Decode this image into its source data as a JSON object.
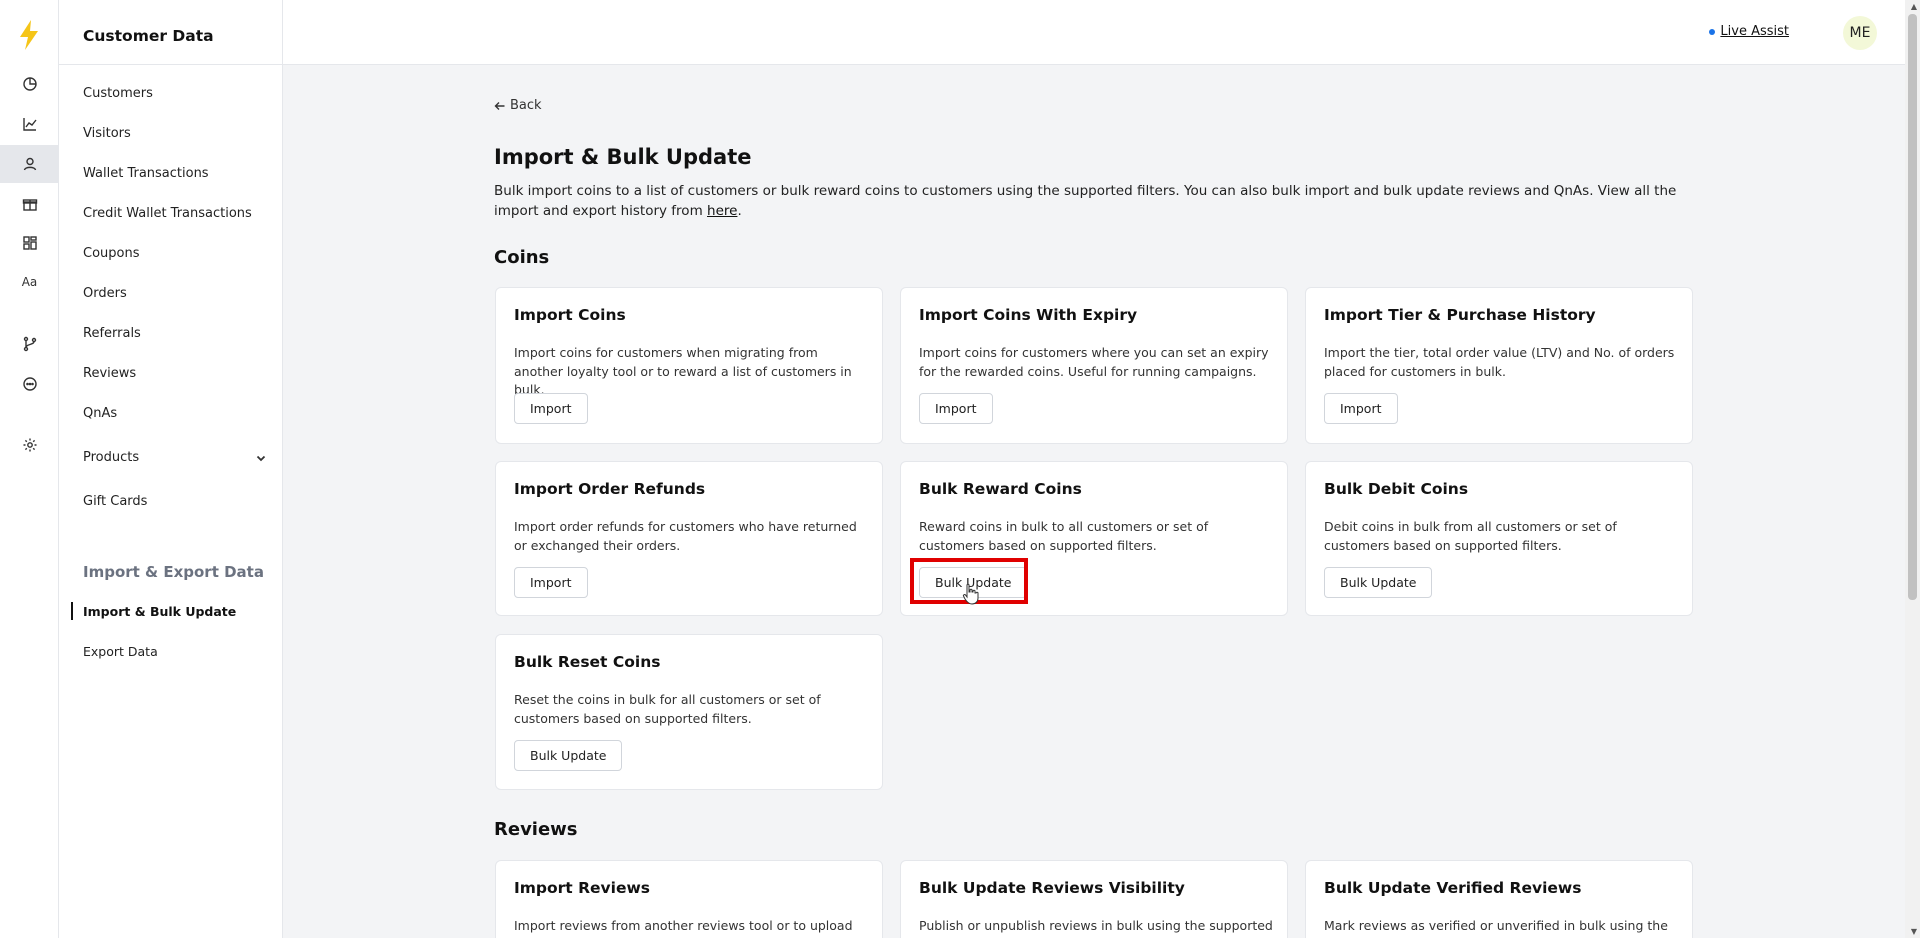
{
  "app": {
    "section_title": "Customer Data"
  },
  "rail": {
    "icons": [
      "lightning-logo",
      "pie-chart-icon",
      "line-chart-icon",
      "user-icon",
      "gift-icon",
      "widgets-icon",
      "typography-icon",
      "branch-icon",
      "chat-icon",
      "gear-icon"
    ],
    "typography_label": "Aa",
    "brand_color": "#f5c518"
  },
  "sidebar": {
    "items": [
      {
        "label": "Customers"
      },
      {
        "label": "Visitors"
      },
      {
        "label": "Wallet Transactions"
      },
      {
        "label": "Credit Wallet Transactions"
      },
      {
        "label": "Coupons"
      },
      {
        "label": "Orders"
      },
      {
        "label": "Referrals"
      },
      {
        "label": "Reviews"
      },
      {
        "label": "QnAs"
      },
      {
        "label": "Products"
      },
      {
        "label": "Gift Cards"
      }
    ],
    "section": "Import & Export Data",
    "sub_items": [
      {
        "label": "Import & Bulk Update",
        "active": true
      },
      {
        "label": "Export Data",
        "active": false
      }
    ]
  },
  "topbar": {
    "live_assist": "Live Assist",
    "avatar_initials": "ME"
  },
  "main": {
    "back_label": "Back",
    "title": "Import & Bulk Update",
    "description_prefix": "Bulk import coins to a list of customers or bulk reward coins to customers using the supported filters. You can also bulk import and bulk update reviews and QnAs. View all the import and export history from ",
    "description_link": "here",
    "description_suffix": ".",
    "coins_heading": "Coins",
    "reviews_heading": "Reviews",
    "coin_cards": [
      {
        "title": "Import Coins",
        "desc": "Import coins for customers when migrating from another loyalty tool or to reward a list of customers in bulk.",
        "button": "Import"
      },
      {
        "title": "Import Coins With Expiry",
        "desc": "Import coins for customers where you can set an expiry for the rewarded coins. Useful for running campaigns.",
        "button": "Import"
      },
      {
        "title": "Import Tier & Purchase History",
        "desc": "Import the tier, total order value (LTV) and No. of orders placed for customers in bulk.",
        "button": "Import"
      },
      {
        "title": "Import Order Refunds",
        "desc": "Import order refunds for customers who have returned or exchanged their orders.",
        "button": "Import"
      },
      {
        "title": "Bulk Reward Coins",
        "desc": "Reward coins in bulk to all customers or set of customers based on supported filters.",
        "button": "Bulk Update"
      },
      {
        "title": "Bulk Debit Coins",
        "desc": "Debit coins in bulk from all customers or set of customers based on supported filters.",
        "button": "Bulk Update"
      },
      {
        "title": "Bulk Reset Coins",
        "desc": "Reset the coins in bulk for all customers or set of customers based on supported filters.",
        "button": "Bulk Update"
      }
    ],
    "review_cards": [
      {
        "title": "Import Reviews",
        "desc": "Import reviews from another reviews tool or to upload"
      },
      {
        "title": "Bulk Update Reviews Visibility",
        "desc": "Publish or unpublish reviews in bulk using the supported"
      },
      {
        "title": "Bulk Update Verified Reviews",
        "desc": "Mark reviews as verified or unverified in bulk using the"
      }
    ]
  },
  "colors": {
    "highlight": "#e00000",
    "live_dot": "#1a73e8"
  }
}
